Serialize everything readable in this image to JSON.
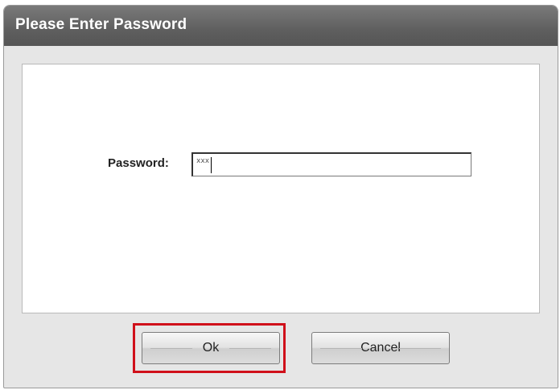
{
  "dialog": {
    "title": "Please Enter Password"
  },
  "form": {
    "password_label": "Password:",
    "password_value": "xxx"
  },
  "buttons": {
    "ok_label": "Ok",
    "cancel_label": "Cancel"
  },
  "colors": {
    "titlebar": "#5f5f5f",
    "highlight": "#d0101a",
    "dialog_bg": "#e6e6e6"
  }
}
